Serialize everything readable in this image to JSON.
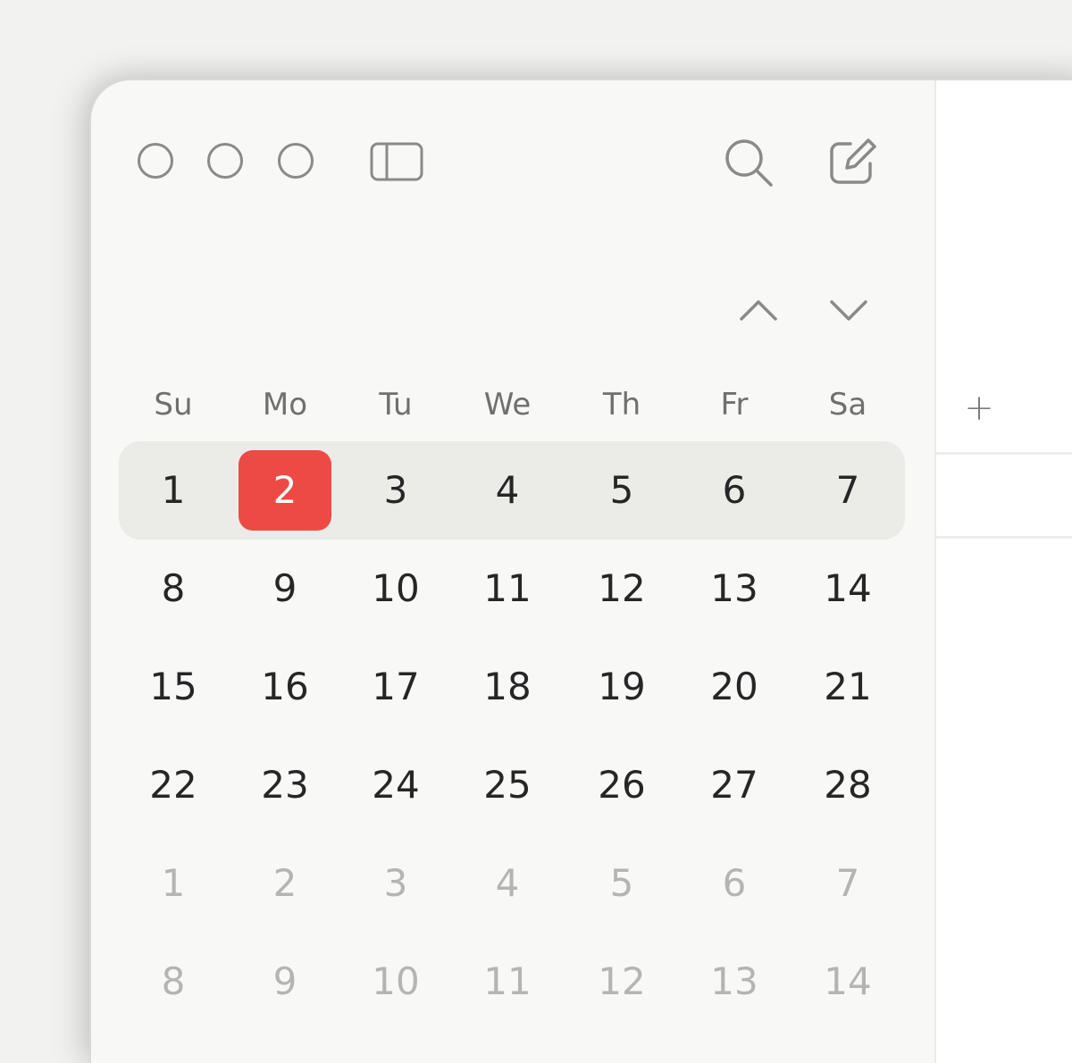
{
  "toolbar": {
    "traffic_lights": [
      "close-button",
      "minimize-button",
      "zoom-button"
    ],
    "icons": {
      "sidebar": "sidebar-toggle-icon",
      "search": "search-icon",
      "compose": "compose-icon",
      "previous_month": "chevron-up-icon",
      "next_month": "chevron-down-icon",
      "add": "plus-icon"
    }
  },
  "calendar": {
    "weekdays": [
      "Su",
      "Mo",
      "Tu",
      "We",
      "Th",
      "Fr",
      "Sa"
    ],
    "weeks": [
      [
        "1",
        "2",
        "3",
        "4",
        "5",
        "6",
        "7"
      ],
      [
        "8",
        "9",
        "10",
        "11",
        "12",
        "13",
        "14"
      ],
      [
        "15",
        "16",
        "17",
        "18",
        "19",
        "20",
        "21"
      ],
      [
        "22",
        "23",
        "24",
        "25",
        "26",
        "27",
        "28"
      ],
      [
        "1",
        "2",
        "3",
        "4",
        "5",
        "6",
        "7"
      ],
      [
        "8",
        "9",
        "10",
        "11",
        "12",
        "13",
        "14"
      ]
    ],
    "current_week_index": 0,
    "today": {
      "week": 0,
      "day": 1
    },
    "muted_weeks": [
      4,
      5
    ]
  },
  "content": {
    "add_label": "+"
  },
  "colors": {
    "accent_today": "#ee4a45",
    "text": "#262626",
    "muted_text": "#b4b4b2",
    "week_highlight": "#ebebe8"
  }
}
